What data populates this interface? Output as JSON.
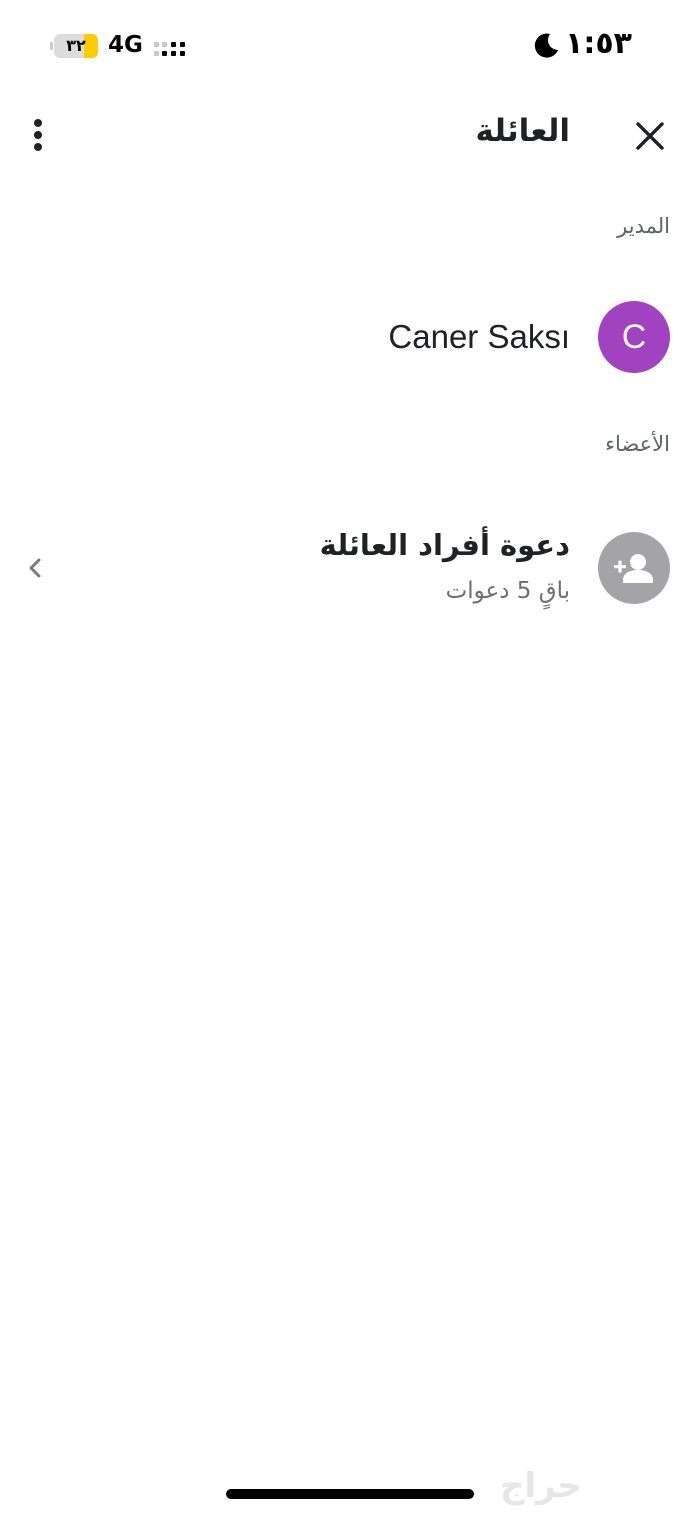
{
  "status": {
    "time": "١:٥٣",
    "network": "4G",
    "battery": "٣٢",
    "battery_level": 0.32
  },
  "header": {
    "title": "العائلة",
    "close_icon": "close-icon",
    "more_icon": "more-vert-icon"
  },
  "manager": {
    "section_label": "المدير",
    "avatar_letter": "C",
    "name": "Caner Saksı",
    "avatar_color": "#a142c0"
  },
  "members": {
    "section_label": "الأعضاء",
    "invite": {
      "title": "دعوة أفراد العائلة",
      "subtitle": "باقٍ 5 دعوات",
      "icon": "person-add-icon",
      "chevron_icon": "chevron-left-icon"
    }
  },
  "watermark": "حراج"
}
